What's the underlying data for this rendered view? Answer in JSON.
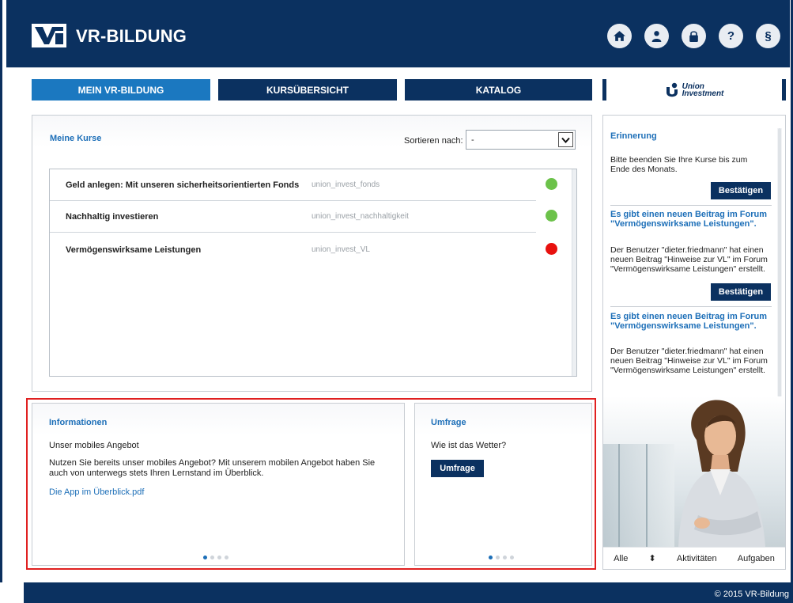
{
  "header": {
    "brand": "VR-BILDUNG",
    "icons": [
      "home-icon",
      "user-icon",
      "lock-icon",
      "help-icon",
      "paragraph-icon"
    ],
    "paragraph_symbol": "§",
    "help_symbol": "?"
  },
  "nav": {
    "tabs": [
      {
        "label": "MEIN VR-BILDUNG",
        "active": true
      },
      {
        "label": "KURSÜBERSICHT",
        "active": false
      },
      {
        "label": "KATALOG",
        "active": false
      }
    ],
    "partner_logo_text_1": "Union",
    "partner_logo_text_2": "Investment"
  },
  "kurse": {
    "title": "Meine Kurse",
    "sort_label": "Sortieren nach:",
    "sort_value": "-",
    "courses": [
      {
        "name": "Geld anlegen: Mit unseren sicherheitsorientierten Fonds",
        "code": "union_invest_fonds",
        "status": "green"
      },
      {
        "name": "Nachhaltig investieren",
        "code": "union_invest_nachhaltigkeit",
        "status": "green"
      },
      {
        "name": "Vermögenswirksame Leistungen",
        "code": "union_invest_VL",
        "status": "red"
      }
    ]
  },
  "info": {
    "title": "Informationen",
    "subtitle": "Unser mobiles Angebot",
    "text": "Nutzen Sie bereits unser mobiles Angebot? Mit unserem mobilen Angebot haben Sie auch von unterwegs stets Ihren Lernstand im Überblick.",
    "link": "Die App im Überblick.pdf",
    "pager_count": 4,
    "pager_active": 0
  },
  "umfrage": {
    "title": "Umfrage",
    "question": "Wie ist das Wetter?",
    "button": "Umfrage",
    "pager_count": 4,
    "pager_active": 0
  },
  "reminder": {
    "title": "Erinnerung",
    "text": "Bitte beenden Sie Ihre Kurse bis zum Ende des Monats.",
    "confirm": "Bestätigen",
    "posts": [
      {
        "head": "Es gibt einen neuen Beitrag im Forum \"Vermögenswirksame Leistungen\".",
        "body": "Der Benutzer \"dieter.friedmann\" hat einen neuen Beitrag \"Hinweise zur VL\" im Forum \"Vermögenswirksame Leistungen\" erstellt.",
        "confirm": "Bestätigen"
      },
      {
        "head": "Es gibt einen neuen Beitrag im Forum \"Vermögenswirksame Leistungen\".",
        "body": "Der Benutzer \"dieter.friedmann\" hat einen neuen Beitrag \"Hinweise zur VL\" im Forum \"Vermögenswirksame Leistungen\" erstellt."
      }
    ],
    "filters": [
      "Alle",
      "Aktivitäten",
      "Aufgaben"
    ],
    "sort_symbol": "⬍"
  },
  "footer": {
    "text": "© 2015 VR-Bildung"
  },
  "colors": {
    "navy": "#0b3160",
    "accent": "#1b78c0",
    "green": "#6cc24a",
    "red": "#e8110e",
    "highlight": "#e02020"
  }
}
